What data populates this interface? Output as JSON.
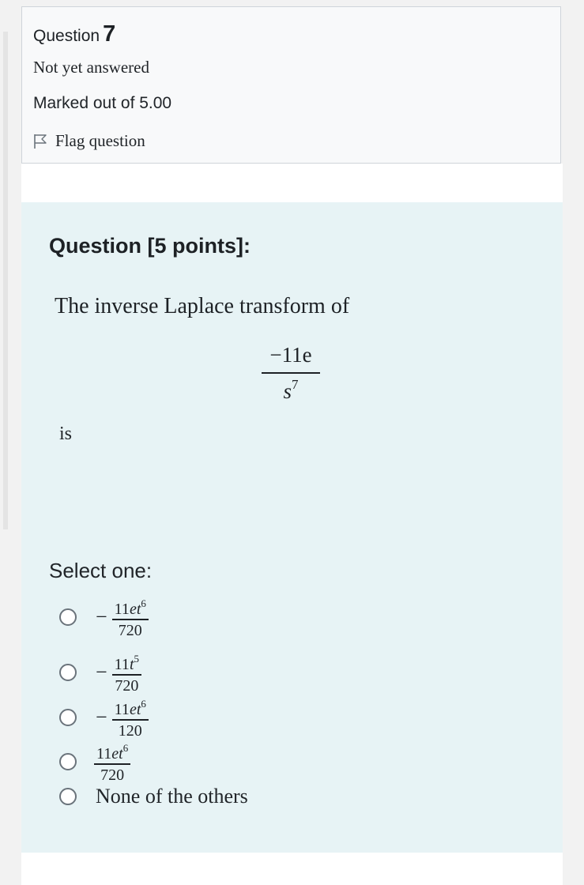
{
  "info": {
    "question_word": "Question",
    "question_number": "7",
    "state": "Not yet answered",
    "grade": "Marked out of 5.00",
    "flag_label": "Flag question"
  },
  "content": {
    "points_title": "Question [5 points]:",
    "question_text": "The inverse Laplace transform of",
    "expression": {
      "numerator": "−11e",
      "denominator_base": "s",
      "denominator_exp": "7"
    },
    "is_text": "is",
    "select_label": "Select one:"
  },
  "options": [
    {
      "sign": "−",
      "num_coef": "11",
      "num_var": "et",
      "num_exp": "6",
      "den": "720"
    },
    {
      "sign": "−",
      "num_coef": "11",
      "num_var": "t",
      "num_exp": "5",
      "den": "720"
    },
    {
      "sign": "−",
      "num_coef": "11",
      "num_var": "et",
      "num_exp": "6",
      "den": "120"
    },
    {
      "sign": "",
      "num_coef": "11",
      "num_var": "et",
      "num_exp": "6",
      "den": "720"
    },
    {
      "text": "None of the others"
    }
  ],
  "colors": {
    "content_bg": "#e7f3f5",
    "info_bg": "#f8f9fa",
    "radio_border": "#6a737b"
  }
}
